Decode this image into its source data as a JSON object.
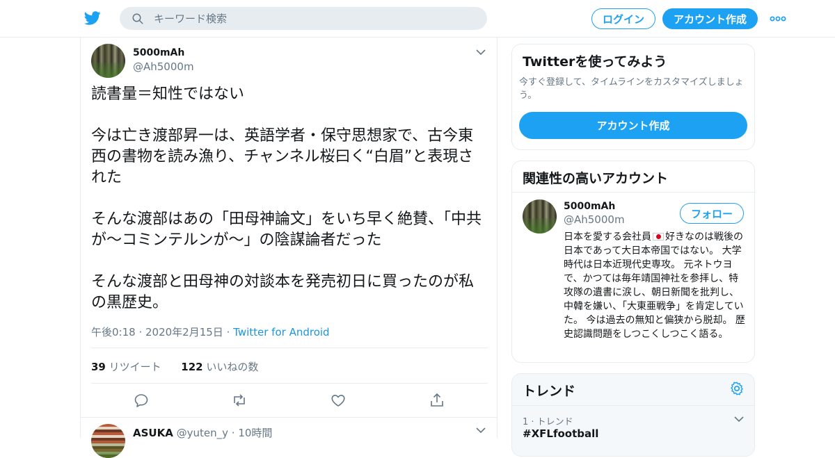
{
  "header": {
    "search_placeholder": "キーワード検索",
    "login_label": "ログイン",
    "signup_label": "アカウント作成"
  },
  "tweet": {
    "author_name": "5000mAh",
    "author_handle": "@Ah5000m",
    "text": "読書量＝知性ではない\n\n今は亡き渡部昇一は、英語学者・保守思想家で、古今東西の書物を読み漁り、チャンネル桜曰く“白眉”と表現された\n\nそんな渡部はあの「田母神論文」をいち早く絶賛、「中共が～コミンテルンが～」の陰謀論者だった\n\nそんな渡部と田母神の対談本を発売初日に買ったのが私の黒歴史。",
    "timestamp": "午後0:18 · 2020年2月15日",
    "separator": "·",
    "source": "Twitter for Android",
    "retweet_count": "39",
    "retweet_label": "リツイート",
    "like_count": "122",
    "like_label": "いいねの数"
  },
  "reply": {
    "author_name": "ASUKA",
    "author_handle": "@yuten_y",
    "time": "· 10時間"
  },
  "sidebar": {
    "try_card": {
      "title": "Twitterを使ってみよう",
      "description": "今すぐ登録して、タイムラインをカスタマイズしましょう。",
      "button_label": "アカウント作成"
    },
    "relevant_card": {
      "title": "関連性の高いアカウント",
      "account_name": "5000mAh",
      "account_handle": "@Ah5000m",
      "follow_label": "フォロー",
      "bio_before_flag": "日本を愛する会社員",
      "bio_after_flag": "好きなのは戦後の日本であって大日本帝国ではない。 大学時代は日本近現代史専攻。 元ネトウヨで、かつては毎年靖国神社を参拝し、特攻隊の遺書に涙し、朝日新聞を批判し、中韓を嫌い、「大東亜戦争」を肯定していた。 今は過去の無知と偏狭から脱却。 歴史認識問題をしつこくしつこく語る。"
    },
    "trends_card": {
      "title": "トレンド",
      "rank_label": "1 · トレンド",
      "topic": "#XFLfootball"
    }
  },
  "colors": {
    "accent": "#1da1f2",
    "secondary_text": "#657786",
    "border": "#e6ecf0"
  },
  "icons": [
    "twitter-bird-icon",
    "search-icon",
    "more-dots-icon",
    "chevron-down-icon",
    "reply-icon",
    "retweet-icon",
    "like-heart-icon",
    "share-icon",
    "gear-icon",
    "japan-flag-emoji"
  ]
}
